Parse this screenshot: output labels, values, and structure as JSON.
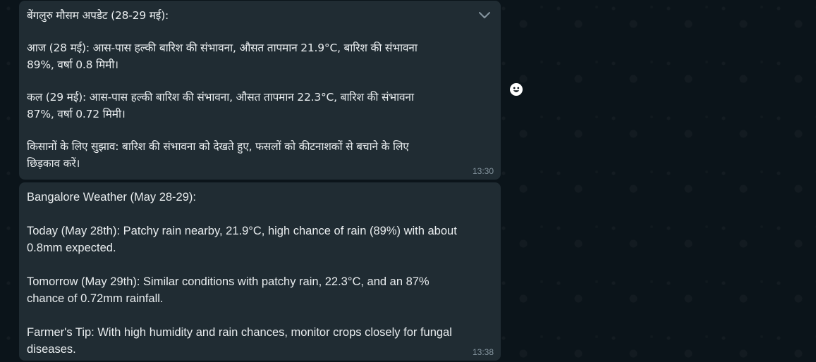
{
  "messages": [
    {
      "lang": "hi",
      "paragraphs": [
        "बेंगलुरु मौसम अपडेट (28-29 मई):",
        "आज (28 मई): आस-पास हल्की बारिश की संभावना, औसत तापमान 21.9°C, बारिश की संभावना\n89%, वर्षा 0.8 मिमी।",
        "कल (29 मई): आस-पास हल्की बारिश की संभावना, औसत तापमान 22.3°C, बारिश की संभावना\n87%, वर्षा 0.72 मिमी।",
        "किसानों के लिए सुझाव: बारिश की संभावना को देखते हुए, फसलों को कीटनाशकों से बचाने के लिए\nछिड़काव करें।"
      ],
      "time": "13:30",
      "menu_icon": "chevron-down-icon",
      "reaction_icon": "smiley-icon"
    },
    {
      "lang": "en",
      "paragraphs": [
        "Bangalore Weather (May 28-29):",
        "Today (May 28th): Patchy rain nearby, 21.9°C, high chance of rain (89%) with about\n0.8mm expected.",
        "Tomorrow (May 29th): Similar conditions with patchy rain, 22.3°C, and an 87%\nchance of 0.72mm rainfall.",
        "Farmer's Tip: With high humidity and rain chances, monitor crops closely for fungal\ndiseases."
      ],
      "time": "13:38"
    }
  ],
  "colors": {
    "chat_background": "#0b141a",
    "bubble_background": "#202c33",
    "text": "#e9edef",
    "meta_text": "#8696a0"
  }
}
